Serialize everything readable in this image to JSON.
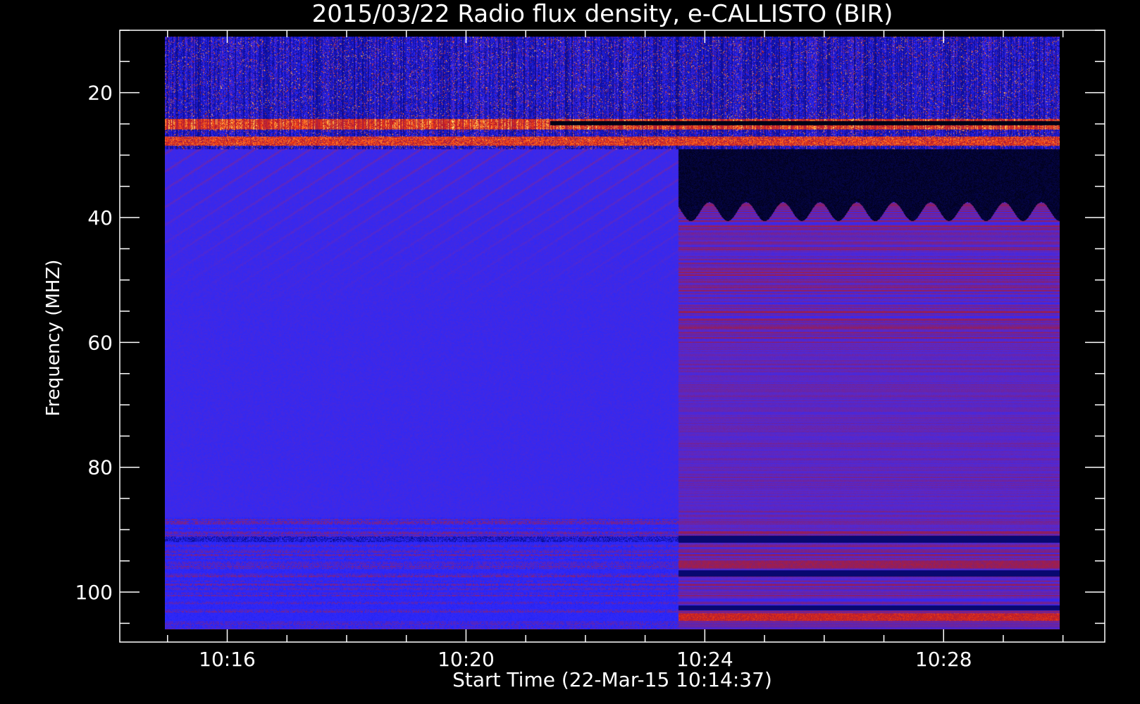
{
  "chart_data": {
    "type": "heatmap",
    "title": "2015/03/22  Radio flux density, e-CALLISTO (BIR)",
    "xlabel": "Start Time (22-Mar-15 10:14:37)",
    "ylabel": "Frequency (MHZ)",
    "x_ticks": [
      "10:16",
      "10:20",
      "10:24",
      "10:28"
    ],
    "x_tick_minutes": [
      16,
      20,
      24,
      28
    ],
    "x_range_minutes": [
      14.2,
      30.7
    ],
    "y_ticks": [
      20,
      40,
      60,
      80,
      100
    ],
    "y_range": [
      10,
      108
    ],
    "y_inverted": true,
    "data_extent": {
      "start_minute": 14.95,
      "end_minute": 29.95,
      "freq_min": 11,
      "freq_max": 106
    },
    "receiver_switch_minute": 23.55,
    "background_color": "#000000",
    "colormap": [
      "#000000",
      "#0a0a8c",
      "#2828ff",
      "#5a28c8",
      "#8c1e64",
      "#c81e1e",
      "#ff5014",
      "#ffa03c",
      "#ffff8c"
    ],
    "interference_band_mhz": [
      11,
      29
    ],
    "dark_lanes": [
      {
        "freq": 25,
        "from_minute": 14.95,
        "to_minute": 29.95,
        "note": ""
      }
    ]
  }
}
